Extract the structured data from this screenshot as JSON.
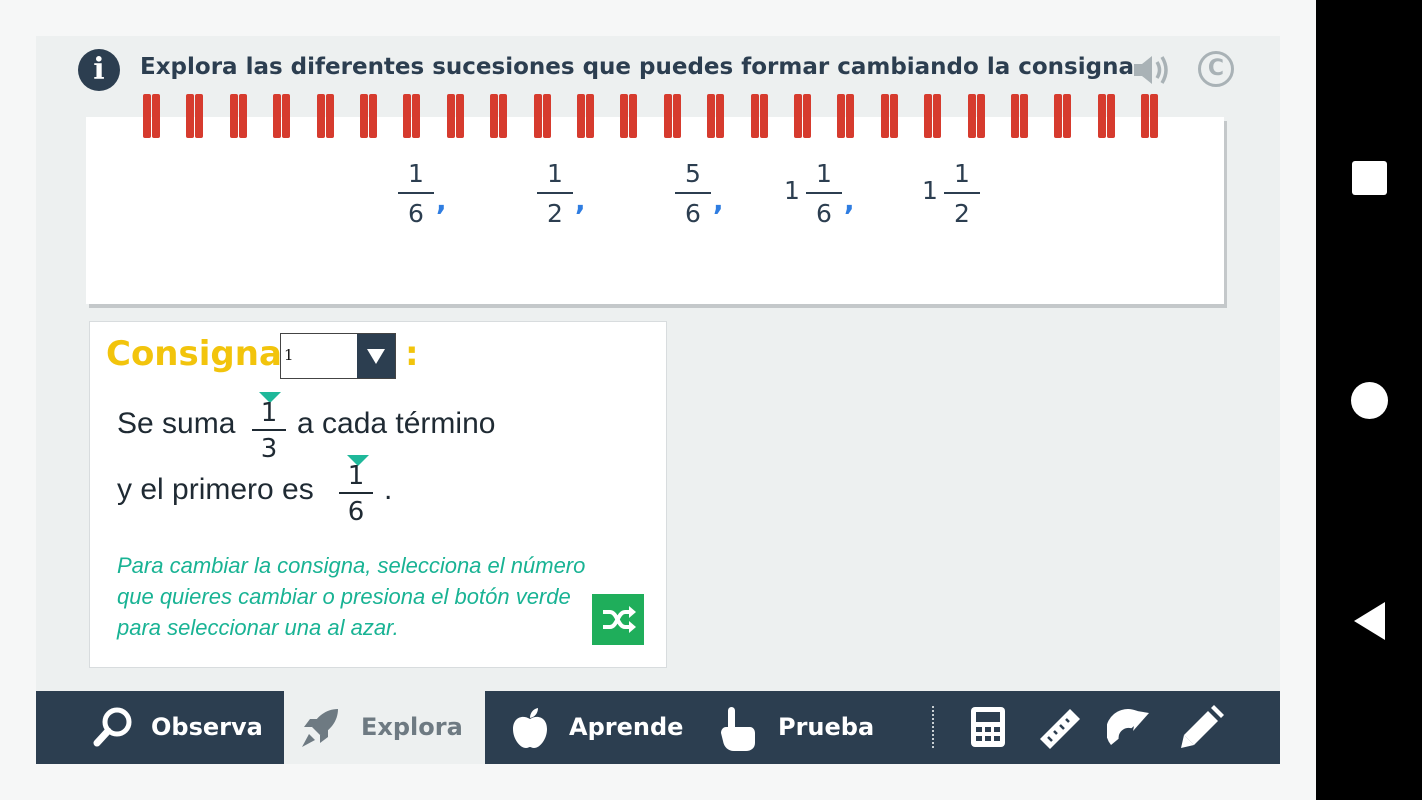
{
  "header": {
    "instruction": "Explora las diferentes sucesiones que puedes formar cambiando la consigna.",
    "copyright_symbol": "C"
  },
  "sequence": {
    "terms": [
      {
        "whole": "",
        "numerator": "1",
        "denominator": "6",
        "separator": ","
      },
      {
        "whole": "",
        "numerator": "1",
        "denominator": "2",
        "separator": ","
      },
      {
        "whole": "",
        "numerator": "5",
        "denominator": "6",
        "separator": ","
      },
      {
        "whole": "1",
        "numerator": "1",
        "denominator": "6",
        "separator": ","
      },
      {
        "whole": "1",
        "numerator": "1",
        "denominator": "2",
        "separator": ""
      }
    ],
    "separator_color": "#2f7de1"
  },
  "consigna": {
    "title": "Consigna",
    "colon": ":",
    "selected_value": "1",
    "rule_line1_before": "Se suma",
    "rule_line1_after": "a cada término",
    "increment_numerator": "1",
    "increment_denominator": "3",
    "rule_line2_before": "y el primero es",
    "rule_line2_after": ".",
    "first_numerator": "1",
    "first_denominator": "6",
    "help": "Para cambiar la consigna, selecciona el número que quieres cambiar o presiona el botón verde para seleccionar una al azar."
  },
  "bottom_bar": {
    "tabs": [
      "Observa",
      "Explora",
      "Aprende",
      "Prueba"
    ],
    "active_tab": "Explora",
    "tools": [
      "calculator-icon",
      "ruler-icon",
      "protractor-icon",
      "pencil-icon"
    ]
  },
  "colors": {
    "primary_dark": "#2c3e50",
    "accent_yellow": "#f2c40c",
    "accent_green": "#1fae5b",
    "help_teal": "#19b394",
    "spiral_red": "#d63b2e"
  }
}
